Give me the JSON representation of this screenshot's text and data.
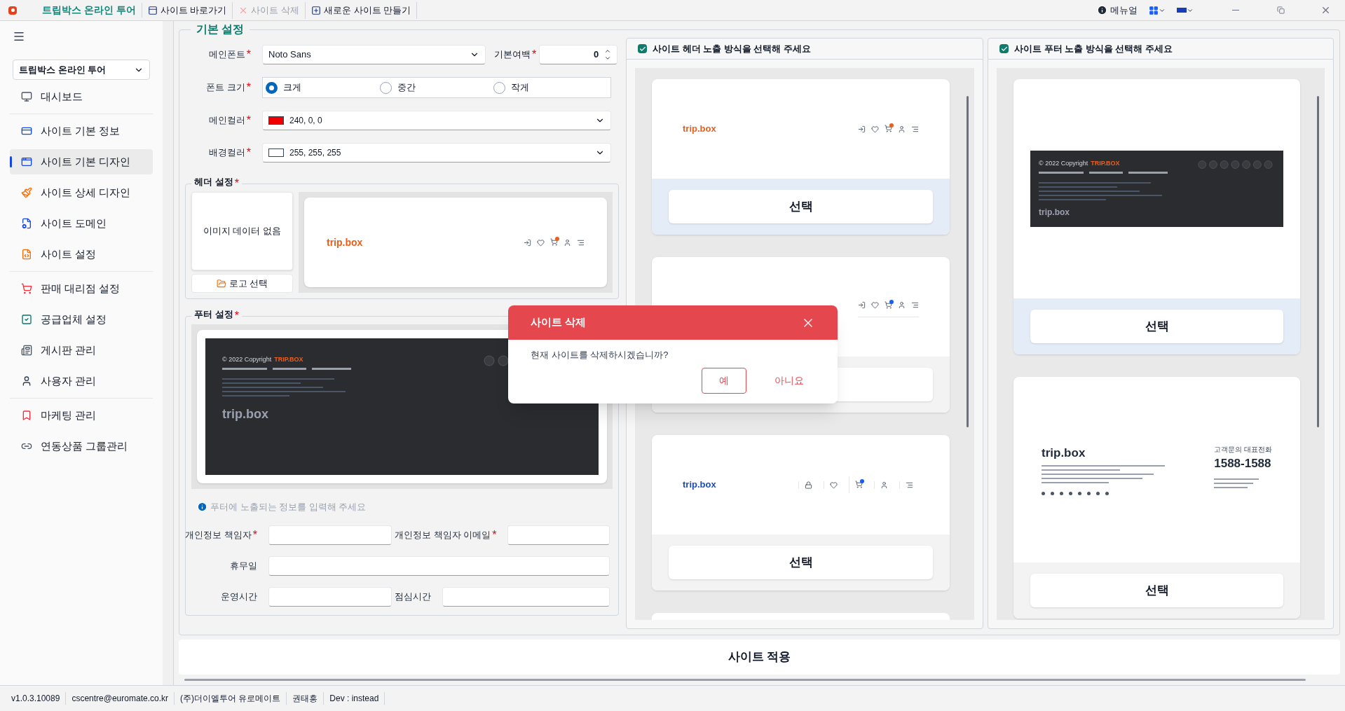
{
  "titlebar": {
    "app_name": "트립박스 온라인 투어",
    "actions": [
      {
        "label": "사이트 바로가기",
        "disabled": false
      },
      {
        "label": "사이트 삭제",
        "disabled": true
      },
      {
        "label": "새로운 사이트 만들기",
        "disabled": false
      }
    ],
    "manual": "메뉴얼"
  },
  "sidebar": {
    "site_select": "트립박스 온라인 투어",
    "menu_groups": [
      {
        "items": [
          {
            "label": "대시보드",
            "selected": false
          }
        ]
      },
      {
        "items": [
          {
            "label": "사이트 기본 정보",
            "selected": false
          },
          {
            "label": "사이트 기본 디자인",
            "selected": true
          },
          {
            "label": "사이트 상세 디자인",
            "selected": false
          },
          {
            "label": "사이트 도메인",
            "selected": false
          },
          {
            "label": "사이트 설정",
            "selected": false
          }
        ]
      },
      {
        "items": [
          {
            "label": "판매 대리점 설정",
            "selected": false
          },
          {
            "label": "공급업체 설정",
            "selected": false
          },
          {
            "label": "게시판 관리",
            "selected": false
          },
          {
            "label": "사용자 관리",
            "selected": false
          }
        ]
      },
      {
        "items": [
          {
            "label": "마케팅 관리",
            "selected": false
          },
          {
            "label": "연동상품 그룹관리",
            "selected": false
          }
        ]
      }
    ]
  },
  "basic_settings": {
    "title": "기본 설정",
    "main_font": {
      "label": "메인폰트",
      "required_mark": "*",
      "value": "Noto Sans"
    },
    "margin": {
      "label": "기본여백",
      "required_mark": "*",
      "value": "0"
    },
    "font_size": {
      "label": "폰트 크기",
      "required_mark": "*",
      "options": [
        {
          "label": "크게",
          "selected": true
        },
        {
          "label": "중간",
          "selected": false
        },
        {
          "label": "작게",
          "selected": false
        }
      ]
    },
    "main_color": {
      "label": "메인컬러",
      "required_mark": "*",
      "value": "240, 0, 0",
      "color": "#f00000"
    },
    "bg_color": {
      "label": "배경컬러",
      "required_mark": "*",
      "value": "255, 255, 255",
      "color": "#ffffff"
    }
  },
  "header_settings": {
    "title": "헤더 설정",
    "required_mark": "*",
    "no_image": "이미지 데이터 없음",
    "logo_button": "로고 선택",
    "preview_logo": "trip.box"
  },
  "footer_settings": {
    "title": "푸터 설정",
    "required_mark": "*",
    "preview": {
      "copyright": "© 2022 Copyright",
      "brand": "TRIP.BOX",
      "logo": "trip.box"
    },
    "info": "푸터에 노출되는 정보를 입력해 주세요",
    "rows": [
      [
        {
          "label": "개인정보 책임자",
          "required_mark": "*"
        },
        {
          "label": "개인정보 책임자 이메일",
          "required_mark": "*"
        }
      ],
      [
        {
          "label": "휴무일"
        }
      ],
      [
        {
          "label": "운영시간"
        },
        {
          "label": "점심시간"
        }
      ]
    ]
  },
  "header_options": {
    "title": "사이트 헤더 노출 방식을 선택해 주세요",
    "checked": true,
    "cards": [
      {
        "kind": "classic",
        "logo": "trip.box",
        "button": "선택",
        "selected": true
      },
      {
        "kind": "underline",
        "selected": false
      },
      {
        "kind": "boxed",
        "logo": "trip.box",
        "button": "선택",
        "selected": false
      },
      {
        "kind": "blank",
        "selected": false
      }
    ]
  },
  "footer_options": {
    "title": "사이트 푸터 노출 방식을 선택해 주세요",
    "checked": true,
    "cards": [
      {
        "kind": "dark",
        "copyright": "© 2022 Copyright",
        "brand": "TRIP.BOX",
        "logo": "trip.box",
        "button": "선택",
        "selected": true
      },
      {
        "kind": "light",
        "logo": "trip.box",
        "phone_label": "고객문의 대표전화",
        "phone": "1588-1588",
        "button": "선택",
        "selected": false
      }
    ]
  },
  "apply_button": "사이트 적용",
  "dialog": {
    "title": "사이트 삭제",
    "message": "현재 사이트를 삭제하시겠습니까?",
    "buttons": [
      {
        "label": "예",
        "kind": "outlined"
      },
      {
        "label": "아니요",
        "kind": "text"
      }
    ]
  },
  "status_bar": [
    "v1.0.3.10089",
    "cscentre@euromate.co.kr",
    "(주)더이엘투어 유로메이트",
    "권태흥",
    "Dev : instead"
  ]
}
